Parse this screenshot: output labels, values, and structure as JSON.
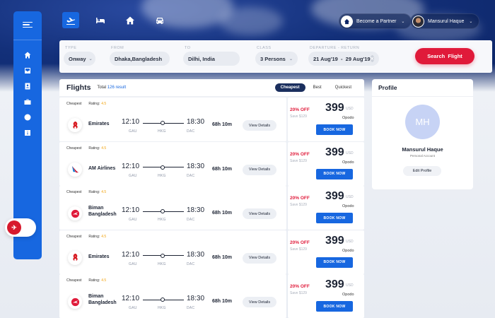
{
  "nav": {
    "tabs": [
      {
        "icon": "plane-departure-icon",
        "active": true
      },
      {
        "icon": "bed-icon",
        "active": false
      },
      {
        "icon": "home-icon",
        "active": false
      },
      {
        "icon": "car-icon",
        "active": false
      }
    ],
    "partner_label": "Become a Partner",
    "user_name": "Mansurul Haque"
  },
  "sidebar": {
    "items": [
      "home-icon",
      "inbox-icon",
      "contacts-icon",
      "briefcase-icon",
      "globe-icon",
      "info-icon"
    ]
  },
  "search": {
    "type": {
      "label": "TYPE",
      "value": "Onway"
    },
    "from": {
      "label": "FROM",
      "value": "Dhaka,Bangladesh"
    },
    "to": {
      "label": "TO",
      "value": "Dilhi, India"
    },
    "class": {
      "label": "CLASS",
      "value": "3 Persons"
    },
    "dates": {
      "label": "DEPARTURE - RETURN",
      "value": "21 Aug'19  -  29 Aug'19"
    },
    "button": "Search  Flight"
  },
  "flights": {
    "title": "Flights",
    "total_label": "Total",
    "total_value": "126 result",
    "sort": [
      "Cheapest",
      "Best",
      "Quickest"
    ],
    "sort_active": "Cheapest",
    "items": [
      {
        "tag": "Cheapest",
        "rating_label": "Rating:",
        "rating": "4.5",
        "airline": "Emirates",
        "logo": "emirates-logo-icon",
        "dep_time": "12:10",
        "dep_code": "GAU",
        "via": "HKG",
        "arr_time": "18:30",
        "arr_code": "DAC",
        "duration": "68h 10m",
        "details": "View Details",
        "discount": "20% OFF",
        "save": "Save $129",
        "price": "399",
        "currency": "USD",
        "operator": "Opodo",
        "book": "BOOK NOW"
      },
      {
        "tag": "Cheapest",
        "rating_label": "Rating:",
        "rating": "4.5",
        "airline": "AM Airlines",
        "logo": "american-airlines-logo-icon",
        "dep_time": "12:10",
        "dep_code": "GAU",
        "via": "HKG",
        "arr_time": "18:30",
        "arr_code": "DAC",
        "duration": "68h 10m",
        "details": "View Details",
        "discount": "20% OFF",
        "save": "Save $129",
        "price": "399",
        "currency": "USD",
        "operator": "Opodo",
        "book": "BOOK NOW"
      },
      {
        "tag": "Cheapest",
        "rating_label": "Rating:",
        "rating": "4.5",
        "airline": "Biman Bangladesh",
        "logo": "biman-logo-icon",
        "dep_time": "12:10",
        "dep_code": "GAU",
        "via": "HKG",
        "arr_time": "18:30",
        "arr_code": "DAC",
        "duration": "68h 10m",
        "details": "View Details",
        "discount": "20% OFF",
        "save": "Save $129",
        "price": "399",
        "currency": "USD",
        "operator": "Opodo",
        "book": "BOOK NOW"
      },
      {
        "tag": "Cheapest",
        "rating_label": "Rating:",
        "rating": "4.5",
        "airline": "Emirates",
        "logo": "emirates-logo-icon",
        "dep_time": "12:10",
        "dep_code": "GAU",
        "via": "HKG",
        "arr_time": "18:30",
        "arr_code": "DAC",
        "duration": "68h 10m",
        "details": "View Details",
        "discount": "20% OFF",
        "save": "Save $129",
        "price": "399",
        "currency": "USD",
        "operator": "Opodo",
        "book": "BOOK NOW"
      },
      {
        "tag": "Cheapest",
        "rating_label": "Rating:",
        "rating": "4.5",
        "airline": "Biman Bangladesh",
        "logo": "biman-logo-icon",
        "dep_time": "12:10",
        "dep_code": "GAU",
        "via": "HKG",
        "arr_time": "18:30",
        "arr_code": "DAC",
        "duration": "68h 10m",
        "details": "View Details",
        "discount": "20% OFF",
        "save": "Save $129",
        "price": "399",
        "currency": "USD",
        "operator": "Opodo",
        "book": "BOOK NOW"
      }
    ]
  },
  "profile": {
    "title": "Profile",
    "initials": "MH",
    "name": "Mansurul Haque",
    "account": "Personal Account",
    "edit": "Edit Profile"
  },
  "colors": {
    "primary": "#1767e0",
    "accent": "#e01a3a",
    "navy": "#0d2566"
  }
}
